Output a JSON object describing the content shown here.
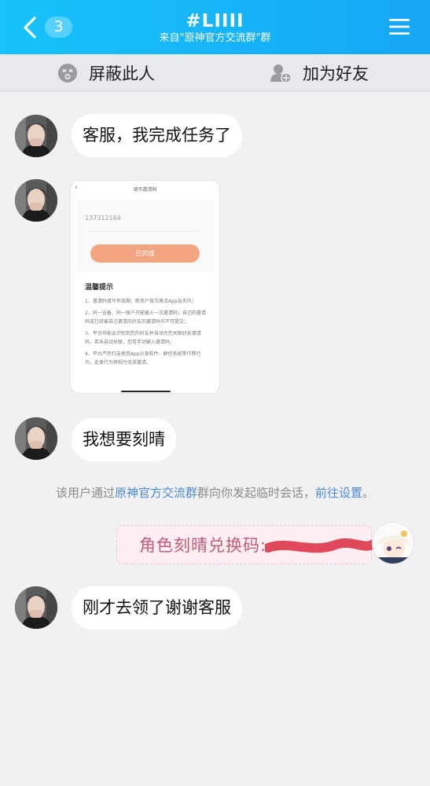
{
  "header": {
    "badge": "3",
    "title": "#LIIII",
    "subtitle": "来自\"原神官方交流群\"群"
  },
  "actionbar": {
    "block_label": "屏蔽此人",
    "add_friend_label": "加为好友"
  },
  "messages": [
    {
      "from": "other",
      "type": "text",
      "text": "客服，我完成任务了"
    },
    {
      "from": "other",
      "type": "image",
      "image": {
        "title": "填写邀请码",
        "code": "137312164",
        "button": "已完成",
        "tips_title": "温馨提示",
        "tips": [
          "1、邀请码填写有效期：新用户首次激活App当天内；",
          "2、同一设备、同一账户只能输入一次邀请码；自己的邀请码或已经被自己邀请的好友的邀请码均不可提交；",
          "3、平台可能会识别到您的好友并自动为您关联好友邀请码，若未自动关联，您可手动输入邀请码；",
          "4、平台严厉打击使用App分身软件、群控系统等作弊行为，此类行为将视为无效邀请。"
        ]
      }
    },
    {
      "from": "other",
      "type": "text",
      "text": "我想要刻晴"
    },
    {
      "from": "me",
      "type": "sticker",
      "text": "角色刻晴兑换码:"
    },
    {
      "from": "other",
      "type": "text",
      "text": "刚才去领了谢谢客服"
    }
  ],
  "notice": {
    "prefix": "该用户通过",
    "group_link": "原神官方交流群",
    "middle": "群向你发起临时会话，",
    "settings_link": "前往设置",
    "suffix": "。"
  },
  "icons": {
    "back": "chevron-left-icon",
    "menu": "hamburger-menu-icon",
    "block": "block-user-icon",
    "add_friend": "add-friend-icon"
  },
  "colors": {
    "header_start": "#17c3fb",
    "header_end": "#16a6f5",
    "background": "#f1f1f3",
    "link": "#4b8ad5",
    "sticker_text": "#c35a79",
    "image_button": "#f3a582"
  }
}
